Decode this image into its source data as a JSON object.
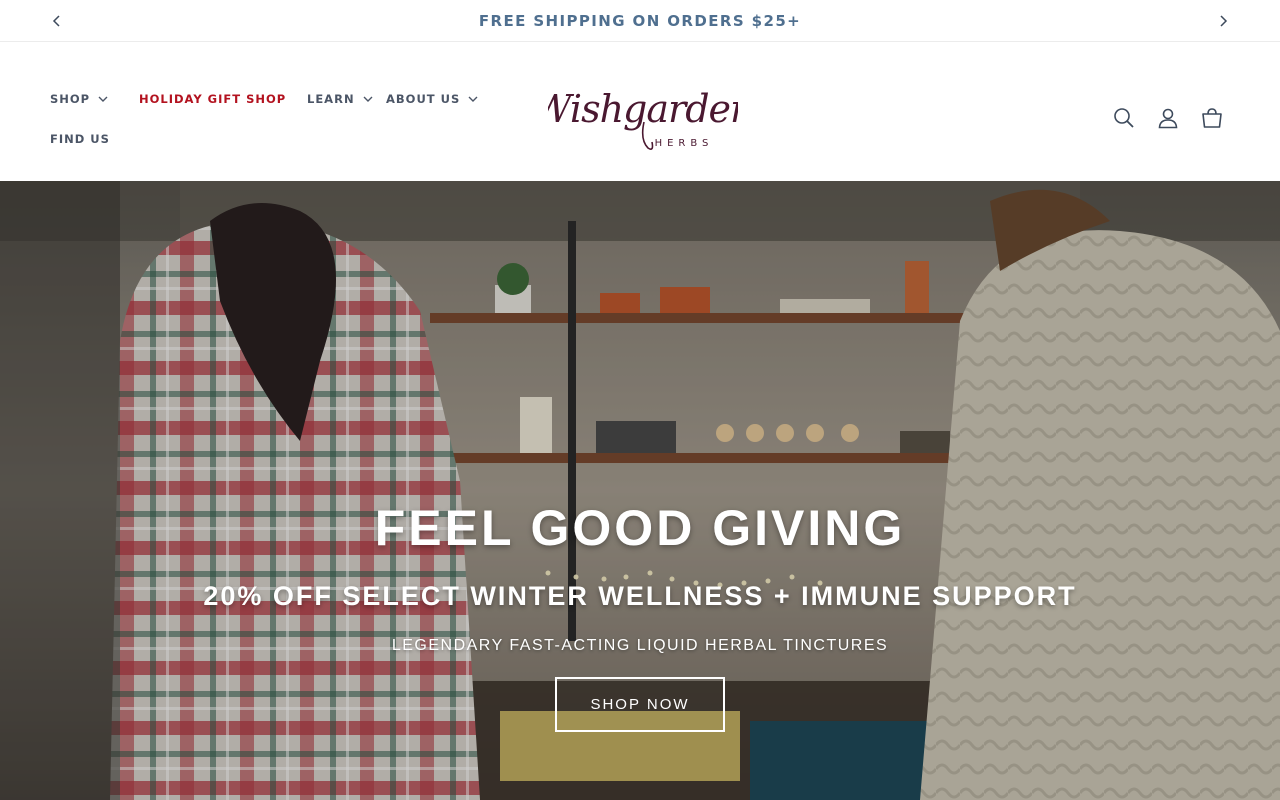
{
  "announcement": {
    "text": "FREE SHIPPING ON ORDERS $25+",
    "prev_icon": "chevron-left-icon",
    "next_icon": "chevron-right-icon"
  },
  "nav": {
    "shop": "SHOP",
    "holiday": "HOLIDAY GIFT SHOP",
    "learn": "LEARN",
    "about": "ABOUT US",
    "find": "FIND US"
  },
  "logo": {
    "name": "Wishgarden",
    "sub": "HERBS"
  },
  "header_icons": [
    "search-icon",
    "account-icon",
    "cart-icon"
  ],
  "hero": {
    "title": "FEEL GOOD GIVING",
    "subtitle": "20% OFF SELECT WINTER WELLNESS + IMMUNE SUPPORT",
    "tagline": "LEGENDARY FAST-ACTING LIQUID HERBAL TINCTURES",
    "cta": "SHOP NOW"
  },
  "colors": {
    "announcement_text": "#4f6f8f",
    "holiday_link": "#b3121f",
    "nav_text": "#4b5566",
    "logo": "#4a1830"
  }
}
